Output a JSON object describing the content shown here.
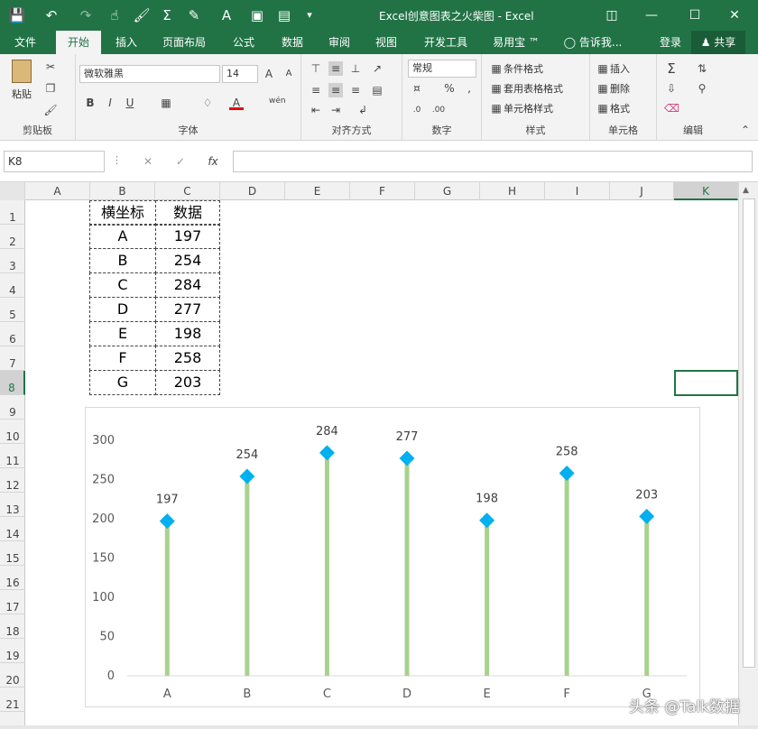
{
  "window": {
    "title": "Excel创意图表之火柴图 - Excel"
  },
  "tabs": [
    "文件",
    "开始",
    "插入",
    "页面布局",
    "公式",
    "数据",
    "审阅",
    "视图",
    "开发工具",
    "易用宝 ™"
  ],
  "tell_me": "告诉我...",
  "login": "登录",
  "share": "共享",
  "ribbon": {
    "paste": "粘贴",
    "clipboard": "剪贴板",
    "font_name": "微软雅黑",
    "font_size": "14",
    "font_group": "字体",
    "align_group": "对齐方式",
    "number_format": "常规",
    "number_group": "数字",
    "cond_format": "条件格式",
    "table_format": "套用表格格式",
    "cell_style": "单元格样式",
    "style_group": "样式",
    "insert": "插入",
    "delete": "删除",
    "format": "格式",
    "cells_group": "单元格",
    "edit_group": "编辑",
    "bold": "B",
    "italic": "I",
    "underline": "U",
    "pct": "%"
  },
  "name_box": "K8",
  "columns": [
    "A",
    "B",
    "C",
    "D",
    "E",
    "F",
    "G",
    "H",
    "I",
    "J",
    "K"
  ],
  "rows": [
    "1",
    "2",
    "3",
    "4",
    "5",
    "6",
    "7",
    "8",
    "9",
    "10",
    "11",
    "12",
    "13",
    "14",
    "15",
    "16",
    "17",
    "18",
    "19",
    "20",
    "21"
  ],
  "table": {
    "header": [
      "横坐标",
      "数据"
    ],
    "rows": [
      [
        "A",
        "197"
      ],
      [
        "B",
        "254"
      ],
      [
        "C",
        "284"
      ],
      [
        "D",
        "277"
      ],
      [
        "E",
        "198"
      ],
      [
        "F",
        "258"
      ],
      [
        "G",
        "203"
      ]
    ]
  },
  "watermark": "头条 @Talk数据",
  "colors": {
    "brand": "#217346",
    "stem": "#a9d18e",
    "marker": "#00b0f0"
  },
  "chart_data": {
    "type": "scatter",
    "subtype": "lollipop",
    "categories": [
      "A",
      "B",
      "C",
      "D",
      "E",
      "F",
      "G"
    ],
    "values": [
      197,
      254,
      284,
      277,
      198,
      258,
      203
    ],
    "data_labels": [
      "197",
      "254",
      "284",
      "277",
      "198",
      "258",
      "203"
    ],
    "ylim": [
      0,
      300
    ],
    "yticks": [
      "0",
      "50",
      "100",
      "150",
      "200",
      "250",
      "300"
    ],
    "grid": false,
    "legend": "none"
  }
}
